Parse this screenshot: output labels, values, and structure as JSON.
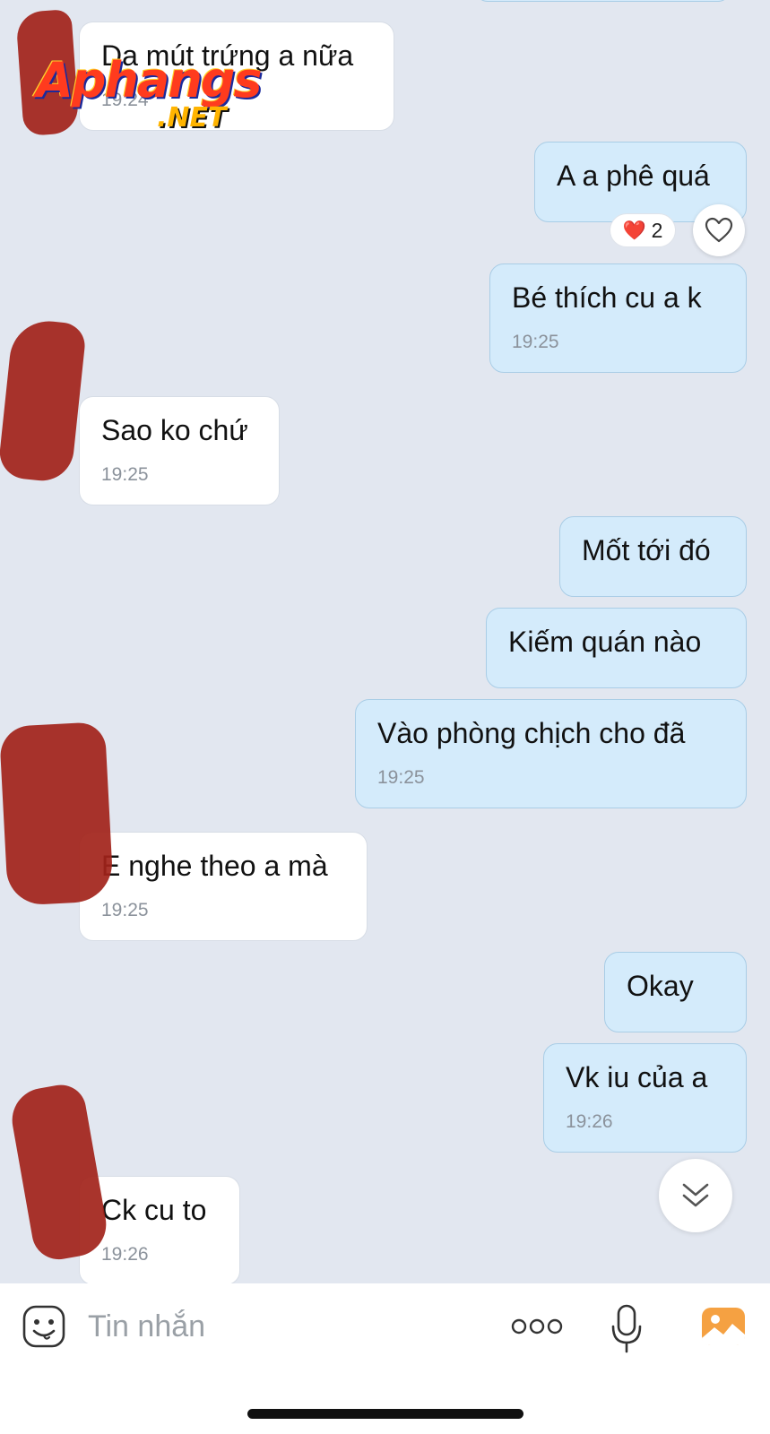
{
  "conversation": {
    "messages": [
      {
        "text": "Da mút trứng a nữa",
        "time": "19:24"
      },
      {
        "text": "A a phê quá"
      },
      {
        "text": "Bé thích cu a k",
        "time": "19:25"
      },
      {
        "text": "Sao ko chứ",
        "time": "19:25"
      },
      {
        "text": "Mốt tới đó"
      },
      {
        "text": "Kiếm quán nào"
      },
      {
        "text": "Vào phòng chịch cho đã",
        "time": "19:25"
      },
      {
        "text": "E nghe theo a mà",
        "time": "19:25"
      },
      {
        "text": "Okay"
      },
      {
        "text": "Vk iu của a",
        "time": "19:26"
      },
      {
        "text": "Ck cu to",
        "time": "19:26"
      }
    ],
    "reaction": {
      "emoji": "❤️",
      "count": "2"
    }
  },
  "composer": {
    "placeholder": "Tin nhắn"
  },
  "watermark": {
    "main": "Aphangs",
    "suffix": ".NET"
  },
  "icons": {
    "emoji": "smiley-icon",
    "more": "more-dots-icon",
    "mic": "microphone-icon",
    "gallery": "image-gallery-icon",
    "heart": "heart-outline-icon",
    "scroll_down": "double-chevron-down-icon"
  },
  "colors": {
    "background": "#e2e7f0",
    "outgoing_bubble": "#d4ebfb",
    "incoming_bubble": "#ffffff",
    "gallery_accent": "#f5a142",
    "redaction": "#a2231a"
  }
}
